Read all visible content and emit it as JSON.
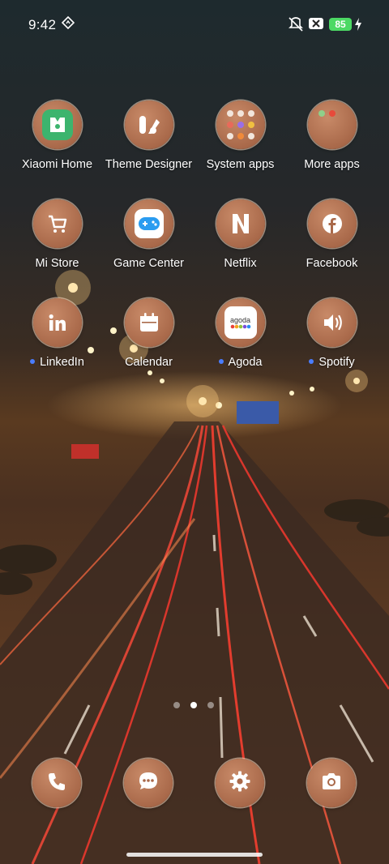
{
  "status_bar": {
    "time": "9:42",
    "battery": "85",
    "icons": [
      "nfc-diamond-icon",
      "vibrate-off-icon",
      "x-box-icon",
      "charging-bolt-icon"
    ],
    "battery_color": "#4cd964"
  },
  "apps": [
    {
      "label": "Xiaomi Home",
      "icon": "xiaomi-home-icon"
    },
    {
      "label": "Theme Designer",
      "icon": "theme-designer-icon"
    },
    {
      "label": "System apps",
      "icon": "system-apps-folder-icon"
    },
    {
      "label": "More apps",
      "icon": "more-apps-folder-icon"
    },
    {
      "label": "Mi Store",
      "icon": "cart-icon"
    },
    {
      "label": "Game Center",
      "icon": "gamepad-icon"
    },
    {
      "label": "Netflix",
      "icon": "netflix-icon"
    },
    {
      "label": "Facebook",
      "icon": "facebook-icon"
    },
    {
      "label": "LinkedIn",
      "icon": "linkedin-icon",
      "new_dot": true
    },
    {
      "label": "Calendar",
      "icon": "calendar-icon"
    },
    {
      "label": "Agoda",
      "icon": "agoda-icon",
      "new_dot": true,
      "icon_text": "agoda"
    },
    {
      "label": "Spotify",
      "icon": "speaker-icon",
      "new_dot": true
    }
  ],
  "dock": [
    {
      "icon": "phone-icon"
    },
    {
      "icon": "messages-icon"
    },
    {
      "icon": "settings-gear-icon"
    },
    {
      "icon": "camera-icon"
    }
  ],
  "page_indicator": {
    "pages": 3,
    "current": 2
  },
  "colors": {
    "icon_bg": "#a9694a",
    "new_dot": "#4a7dff"
  }
}
